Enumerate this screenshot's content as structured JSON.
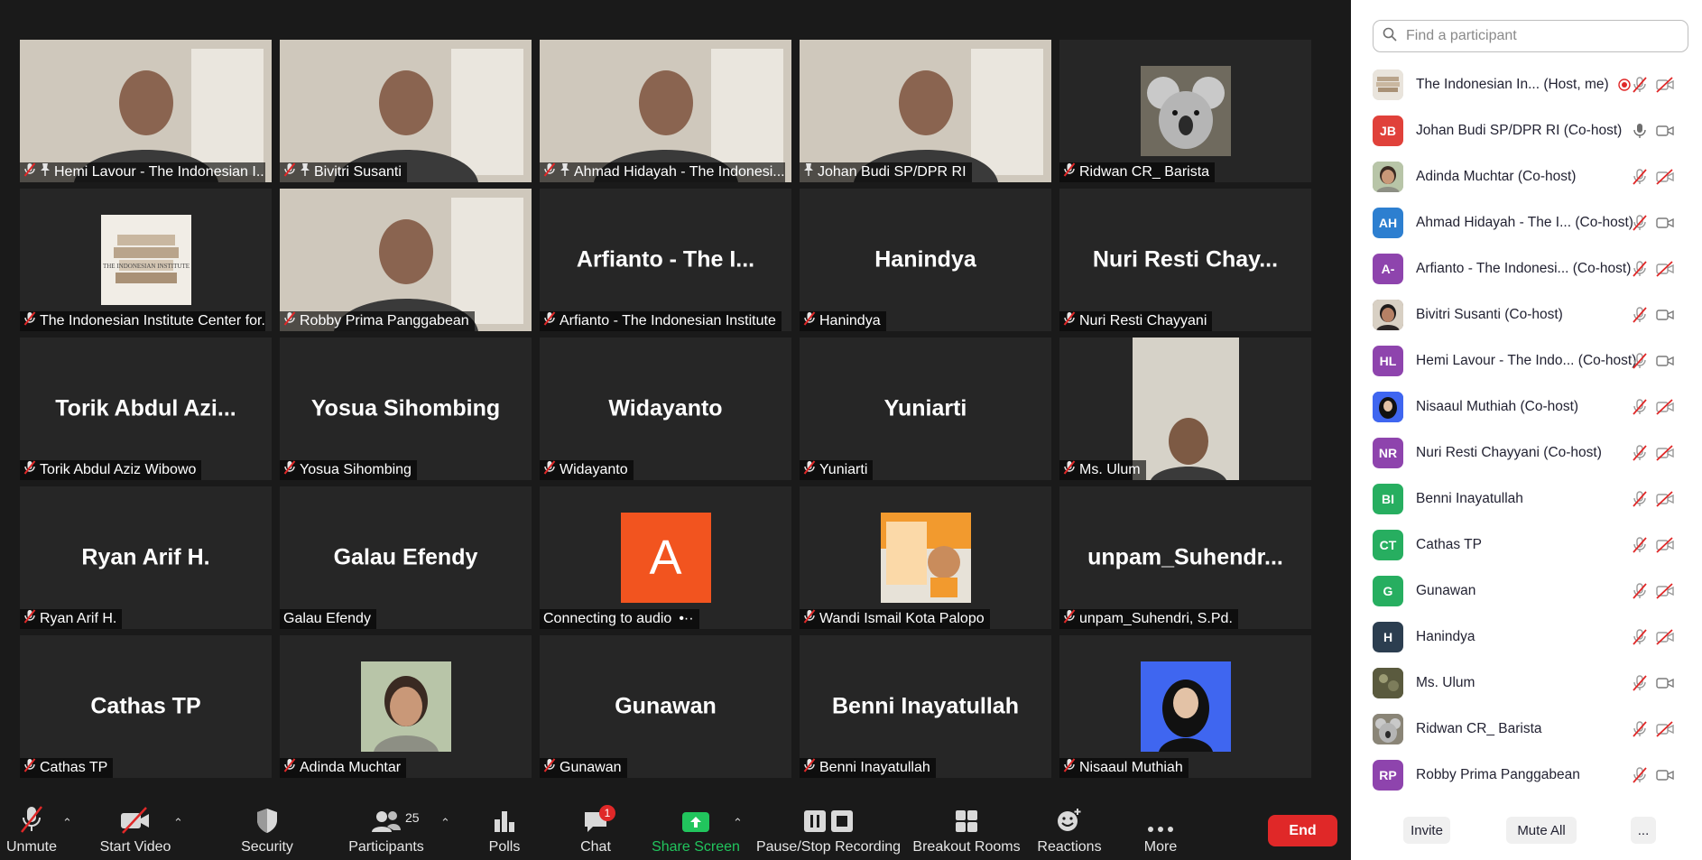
{
  "colors": {
    "active_speaker_border": "#f2f07a",
    "end_button": "#e02828",
    "share_screen_green": "#21c55d",
    "mute_red": "#e02828"
  },
  "gallery": [
    {
      "label": "Hemi Lavour - The Indonesian I...",
      "muted": true,
      "pinned": true,
      "kind": "video"
    },
    {
      "label": "Bivitri Susanti",
      "muted": true,
      "pinned": true,
      "kind": "video"
    },
    {
      "label": "Ahmad Hidayah - The Indonesi...",
      "muted": true,
      "pinned": true,
      "kind": "video"
    },
    {
      "label": "Johan Budi SP/DPR RI",
      "muted": false,
      "pinned": true,
      "kind": "video",
      "active": true
    },
    {
      "label": "Ridwan CR_ Barista",
      "muted": true,
      "kind": "avatar-koala"
    },
    {
      "label": "The Indonesian Institute Center for...",
      "muted": true,
      "kind": "avatar-books"
    },
    {
      "label": "Robby Prima Panggabean",
      "muted": true,
      "kind": "video"
    },
    {
      "label": "Arfianto - The Indonesian Institute",
      "muted": true,
      "kind": "name",
      "big": "Arfianto - The I..."
    },
    {
      "label": "Hanindya",
      "muted": true,
      "kind": "name",
      "big": "Hanindya"
    },
    {
      "label": "Nuri Resti Chayyani",
      "muted": true,
      "kind": "name",
      "big": "Nuri Resti Chay..."
    },
    {
      "label": "Torik Abdul Aziz Wibowo",
      "muted": true,
      "kind": "name",
      "big": "Torik Abdul Azi..."
    },
    {
      "label": "Yosua Sihombing",
      "muted": true,
      "kind": "name",
      "big": "Yosua Sihombing"
    },
    {
      "label": "Widayanto",
      "muted": true,
      "kind": "name",
      "big": "Widayanto"
    },
    {
      "label": "Yuniarti",
      "muted": true,
      "kind": "name",
      "big": "Yuniarti"
    },
    {
      "label": "Ms. Ulum",
      "muted": true,
      "kind": "video-narrow"
    },
    {
      "label": "Ryan Arif H.",
      "muted": true,
      "kind": "name",
      "big": "Ryan Arif H."
    },
    {
      "label": "Galau Efendy",
      "muted": false,
      "kind": "name",
      "big": "Galau Efendy"
    },
    {
      "label": "Connecting to audio",
      "muted": false,
      "kind": "avatar-letter",
      "letter": "A",
      "connecting": true
    },
    {
      "label": "Wandi Ismail Kota Palopo",
      "muted": true,
      "kind": "avatar-poster"
    },
    {
      "label": "unpam_Suhendri, S.Pd.",
      "muted": true,
      "kind": "name",
      "big": "unpam_Suhendr..."
    },
    {
      "label": "Cathas TP",
      "muted": true,
      "kind": "name",
      "big": "Cathas TP"
    },
    {
      "label": "Adinda Muchtar",
      "muted": true,
      "kind": "avatar-face"
    },
    {
      "label": "Gunawan",
      "muted": true,
      "kind": "name",
      "big": "Gunawan"
    },
    {
      "label": "Benni Inayatullah",
      "muted": true,
      "kind": "name",
      "big": "Benni Inayatullah"
    },
    {
      "label": "Nisaaul Muthiah",
      "muted": true,
      "kind": "avatar-hijab"
    }
  ],
  "toolbar": {
    "unmute": "Unmute",
    "start_video": "Start Video",
    "security": "Security",
    "participants": "Participants",
    "participants_count": "25",
    "polls": "Polls",
    "chat": "Chat",
    "chat_badge": "1",
    "share_screen": "Share Screen",
    "recording": "Pause/Stop Recording",
    "breakout": "Breakout Rooms",
    "reactions": "Reactions",
    "more": "More",
    "end": "End"
  },
  "panel": {
    "search_placeholder": "Find a participant",
    "participants": [
      {
        "name": "The Indonesian In...",
        "role": "(Host, me)",
        "initials": "",
        "color": "#d8d8d8",
        "mic": "muted",
        "video": "off",
        "recording": true,
        "avatar": "img-books"
      },
      {
        "name": "Johan Budi SP/DPR RI",
        "role": "(Co-host)",
        "initials": "JB",
        "color": "#e0413a",
        "mic": "on",
        "video": "on"
      },
      {
        "name": "Adinda Muchtar",
        "role": "(Co-host)",
        "initials": "",
        "color": "#a9b59a",
        "mic": "muted",
        "video": "off",
        "avatar": "img-face"
      },
      {
        "name": "Ahmad Hidayah - The I...",
        "role": "(Co-host)",
        "initials": "AH",
        "color": "#2d7fd0",
        "mic": "muted",
        "video": "on"
      },
      {
        "name": "Arfianto - The Indonesi...",
        "role": "(Co-host)",
        "initials": "A-",
        "color": "#8e44ad",
        "mic": "muted",
        "video": "off"
      },
      {
        "name": "Bivitri Susanti",
        "role": "(Co-host)",
        "initials": "",
        "color": "#7a5a4a",
        "mic": "muted",
        "video": "on",
        "avatar": "img-face2"
      },
      {
        "name": "Hemi Lavour - The Indo...",
        "role": "(Co-host)",
        "initials": "HL",
        "color": "#8e44ad",
        "mic": "muted",
        "video": "on"
      },
      {
        "name": "Nisaaul Muthiah",
        "role": "(Co-host)",
        "initials": "",
        "color": "#3c5bd6",
        "mic": "muted",
        "video": "off",
        "avatar": "img-hijab"
      },
      {
        "name": "Nuri Resti Chayyani",
        "role": "(Co-host)",
        "initials": "NR",
        "color": "#8e44ad",
        "mic": "muted",
        "video": "off"
      },
      {
        "name": "Benni Inayatullah",
        "role": "",
        "initials": "BI",
        "color": "#27ae60",
        "mic": "muted",
        "video": "off"
      },
      {
        "name": "Cathas TP",
        "role": "",
        "initials": "CT",
        "color": "#27ae60",
        "mic": "muted",
        "video": "off"
      },
      {
        "name": "Gunawan",
        "role": "",
        "initials": "G",
        "color": "#27ae60",
        "mic": "muted",
        "video": "off"
      },
      {
        "name": "Hanindya",
        "role": "",
        "initials": "H",
        "color": "#2c3e50",
        "mic": "muted",
        "video": "off"
      },
      {
        "name": "Ms. Ulum",
        "role": "",
        "initials": "",
        "color": "#6b6b4a",
        "mic": "muted",
        "video": "on",
        "avatar": "img-dark"
      },
      {
        "name": "Ridwan CR_ Barista",
        "role": "",
        "initials": "",
        "color": "#9a9a9a",
        "mic": "muted",
        "video": "off",
        "avatar": "img-koala"
      },
      {
        "name": "Robby Prima Panggabean",
        "role": "",
        "initials": "RP",
        "color": "#8e44ad",
        "mic": "muted",
        "video": "on"
      }
    ],
    "invite": "Invite",
    "mute_all": "Mute All",
    "more": "..."
  }
}
